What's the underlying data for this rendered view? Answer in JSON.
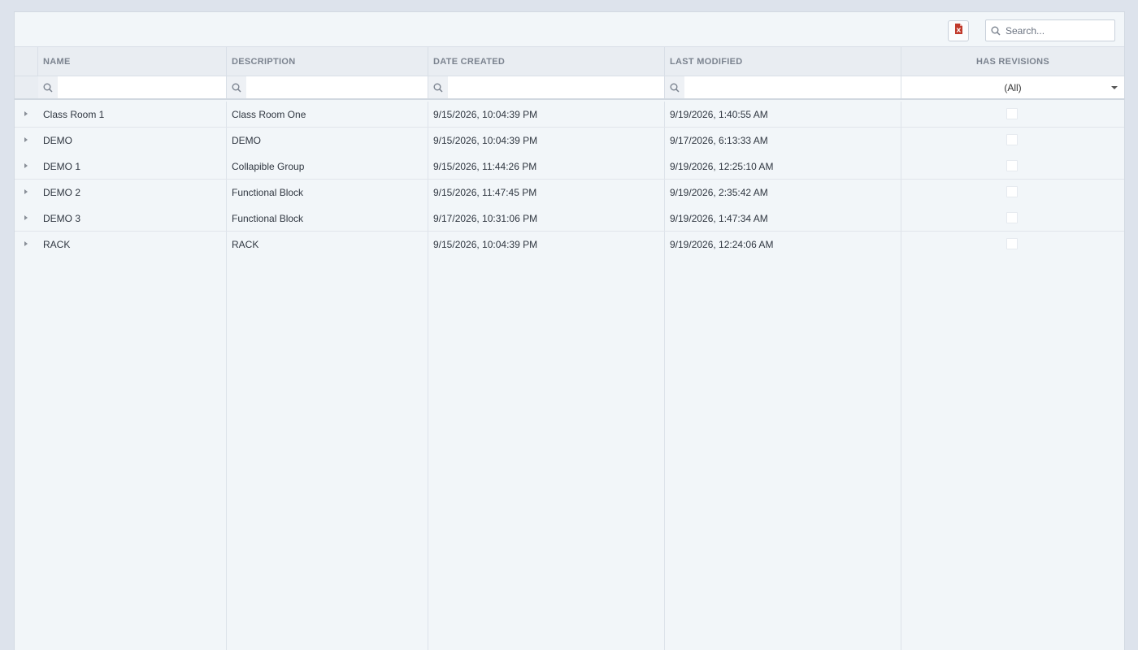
{
  "toolbar": {
    "export_icon": "excel-export-icon",
    "search_icon": "search-icon",
    "search_placeholder": "Search..."
  },
  "columns": {
    "name": "NAME",
    "description": "DESCRIPTION",
    "date_created": "DATE CREATED",
    "last_modified": "LAST MODIFIED",
    "has_revisions": "HAS REVISIONS"
  },
  "filters": {
    "has_revisions_selected": "(All)"
  },
  "rows": [
    {
      "name": "Class Room 1",
      "description": "Class Room One",
      "date_created": "9/15/2026, 10:04:39 PM",
      "last_modified": "9/19/2026, 1:40:55 AM",
      "has_revisions": false
    },
    {
      "name": "DEMO",
      "description": "DEMO",
      "date_created": "9/15/2026, 10:04:39 PM",
      "last_modified": "9/17/2026, 6:13:33 AM",
      "has_revisions": false
    },
    {
      "name": "DEMO 1",
      "description": "Collapible Group",
      "date_created": "9/15/2026, 11:44:26 PM",
      "last_modified": "9/19/2026, 12:25:10 AM",
      "has_revisions": false
    },
    {
      "name": "DEMO 2",
      "description": "Functional Block",
      "date_created": "9/15/2026, 11:47:45 PM",
      "last_modified": "9/19/2026, 2:35:42 AM",
      "has_revisions": false
    },
    {
      "name": "DEMO 3",
      "description": "Functional Block",
      "date_created": "9/17/2026, 10:31:06 PM",
      "last_modified": "9/19/2026, 1:47:34 AM",
      "has_revisions": false
    },
    {
      "name": "RACK",
      "description": "RACK",
      "date_created": "9/15/2026, 10:04:39 PM",
      "last_modified": "9/19/2026, 12:24:06 AM",
      "has_revisions": false
    }
  ],
  "colors": {
    "page_bg": "#dde3ec",
    "panel_bg": "#f2f6f9",
    "header_bg": "#e9edf2",
    "export_red": "#c0392b"
  }
}
